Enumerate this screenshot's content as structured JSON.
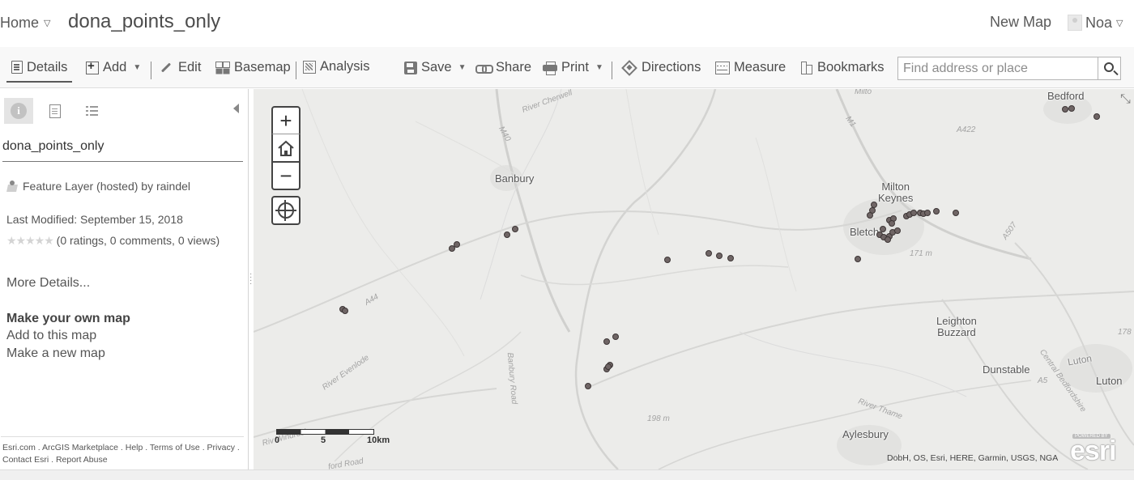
{
  "header": {
    "home_label": "Home",
    "map_title": "dona_points_only",
    "new_map_label": "New Map",
    "user_name": "Noa"
  },
  "toolbar": {
    "details": "Details",
    "add": "Add",
    "edit": "Edit",
    "basemap": "Basemap",
    "analysis": "Analysis",
    "save": "Save",
    "share": "Share",
    "print": "Print",
    "directions": "Directions",
    "measure": "Measure",
    "bookmarks": "Bookmarks",
    "search_placeholder": "Find address or place"
  },
  "panel": {
    "layer_name": "dona_points_only",
    "layer_type": "Feature Layer (hosted) by raindel",
    "last_modified": "Last Modified: September 15, 2018",
    "ratings_text": "(0 ratings, 0 comments, 0 views)",
    "more_details": "More Details...",
    "make_own_map": "Make your own map",
    "add_to_map": "Add to this map",
    "make_new_map": "Make a new map",
    "footer_links": [
      "Esri.com",
      "ArcGIS Marketplace",
      "Help",
      "Terms of Use",
      "Privacy",
      "Contact Esri",
      "Report Abuse"
    ]
  },
  "map": {
    "places": {
      "bedford": "Bedford",
      "banbury": "Banbury",
      "milton_keynes": "Milton\nKeynes",
      "bletchley": "Bletch",
      "leighton_buzzard": "Leighton\nBuzzard",
      "dunstable": "Dunstable",
      "luton": "Luton",
      "luton_small": "Luton",
      "aylesbury": "Aylesbury"
    },
    "faint_labels": {
      "river_cherwell": "River Cherwell",
      "m40": "M40",
      "m1": "M1",
      "a422": "A422",
      "a507": "A507",
      "a44": "A44",
      "river_evenlode": "River Evenlode",
      "banbury_road": "Banbury Road",
      "river_thame": "River Thame",
      "elev_198": "198 m",
      "elev_171": "171 m",
      "central_beds": "Central Bedfordshire",
      "a5": "A5",
      "num_178": "178",
      "milton_top": "Milto",
      "windrush": "Riv Windrush",
      "oxford_road": "ford Road"
    },
    "scale": {
      "zero": "0",
      "five": "5",
      "ten": "10km"
    },
    "attribution": "DobH, OS, Esri, HERE, Garmin, USGS, NGA",
    "logo_powered": "POWERED BY",
    "logo_word": "esri",
    "point_color": "#6f6565"
  }
}
